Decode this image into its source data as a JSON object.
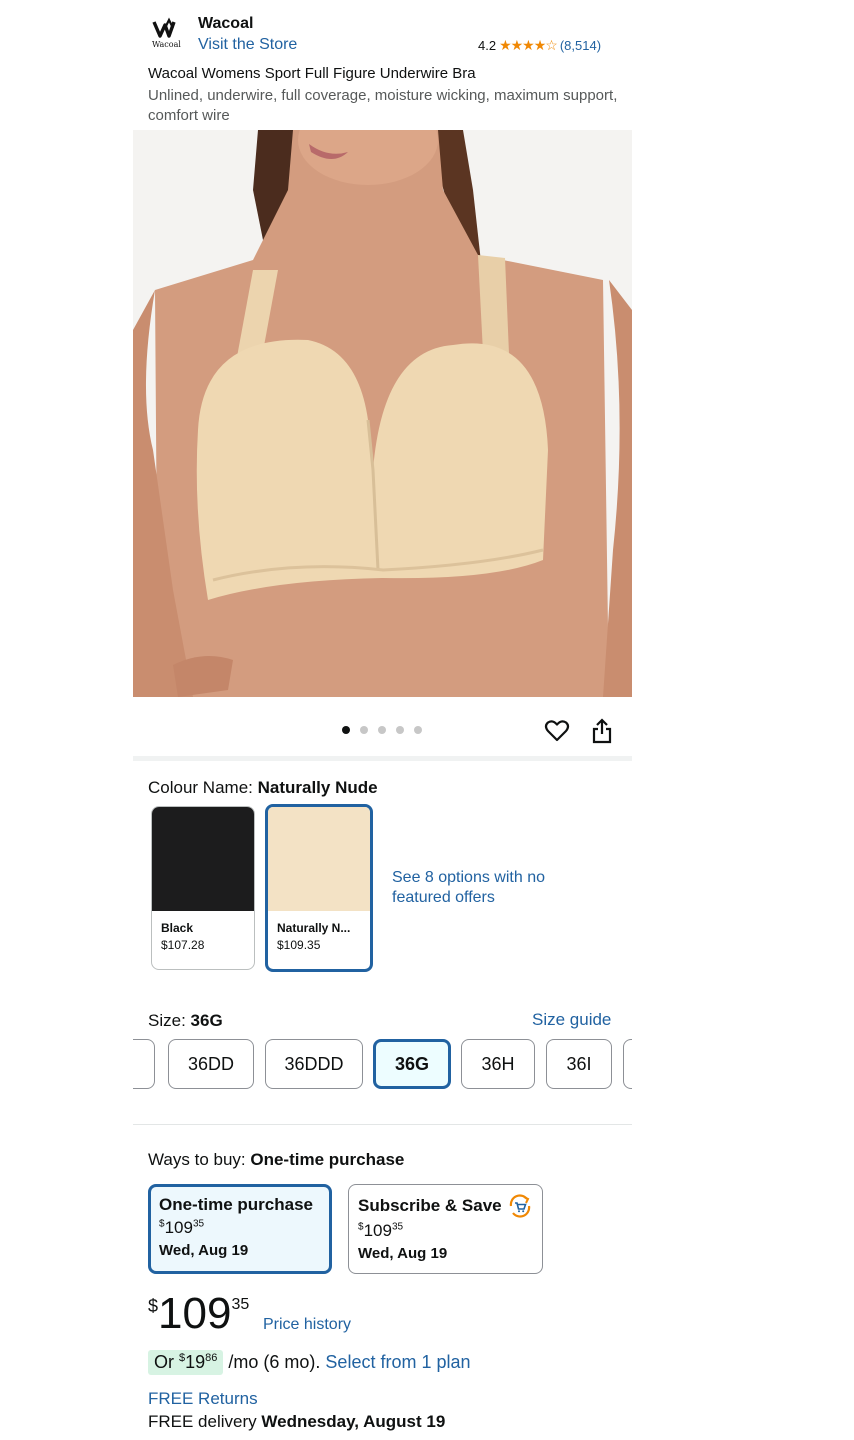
{
  "header": {
    "brand": "Wacoal",
    "logo_text": "Wacoal",
    "visit_store": "Visit the Store",
    "rating": "4.2",
    "stars": "★★★★☆",
    "review_count": "(8,514)",
    "product_title": "Wacoal Womens Sport Full Figure Underwire Bra",
    "product_subtitle": "Unlined, underwire, full coverage, moisture wicking, maximum support, comfort wire"
  },
  "gallery": {
    "image_count": 5,
    "active_index": 0
  },
  "colour": {
    "label": "Colour Name: ",
    "selected": "Naturally Nude",
    "swatches": [
      {
        "name": "Black",
        "price": "$107.28",
        "color": "#1c1c1d"
      },
      {
        "name": "Naturally N...",
        "price": "$109.35",
        "color": "#f3e2c5"
      }
    ],
    "see_options": "See 8 options with no featured offers"
  },
  "size": {
    "label": "Size: ",
    "selected": "36G",
    "size_guide": "Size guide",
    "options": [
      "36DD",
      "36DDD",
      "36G",
      "36H",
      "36I"
    ]
  },
  "ways_to_buy": {
    "label": "Ways to buy: ",
    "selected": "One-time purchase",
    "options": [
      {
        "title": "One-time purchase",
        "price_currency": "$",
        "price_whole": "109",
        "price_fraction": "35",
        "date": "Wed, Aug 19"
      },
      {
        "title": "Subscribe & Save",
        "price_currency": "$",
        "price_whole": "109",
        "price_fraction": "35",
        "date": "Wed, Aug 19"
      }
    ]
  },
  "price": {
    "currency": "$",
    "whole": "109",
    "fraction": "35",
    "history_link": "Price history"
  },
  "finance": {
    "prefix": "Or ",
    "currency": "$",
    "whole": "19",
    "fraction": "86",
    "suffix": " /mo (6 mo). ",
    "link": "Select from 1 plan"
  },
  "shipping": {
    "returns": "FREE Returns",
    "delivery_prefix": "FREE delivery ",
    "delivery_date": "Wednesday, August 19"
  }
}
